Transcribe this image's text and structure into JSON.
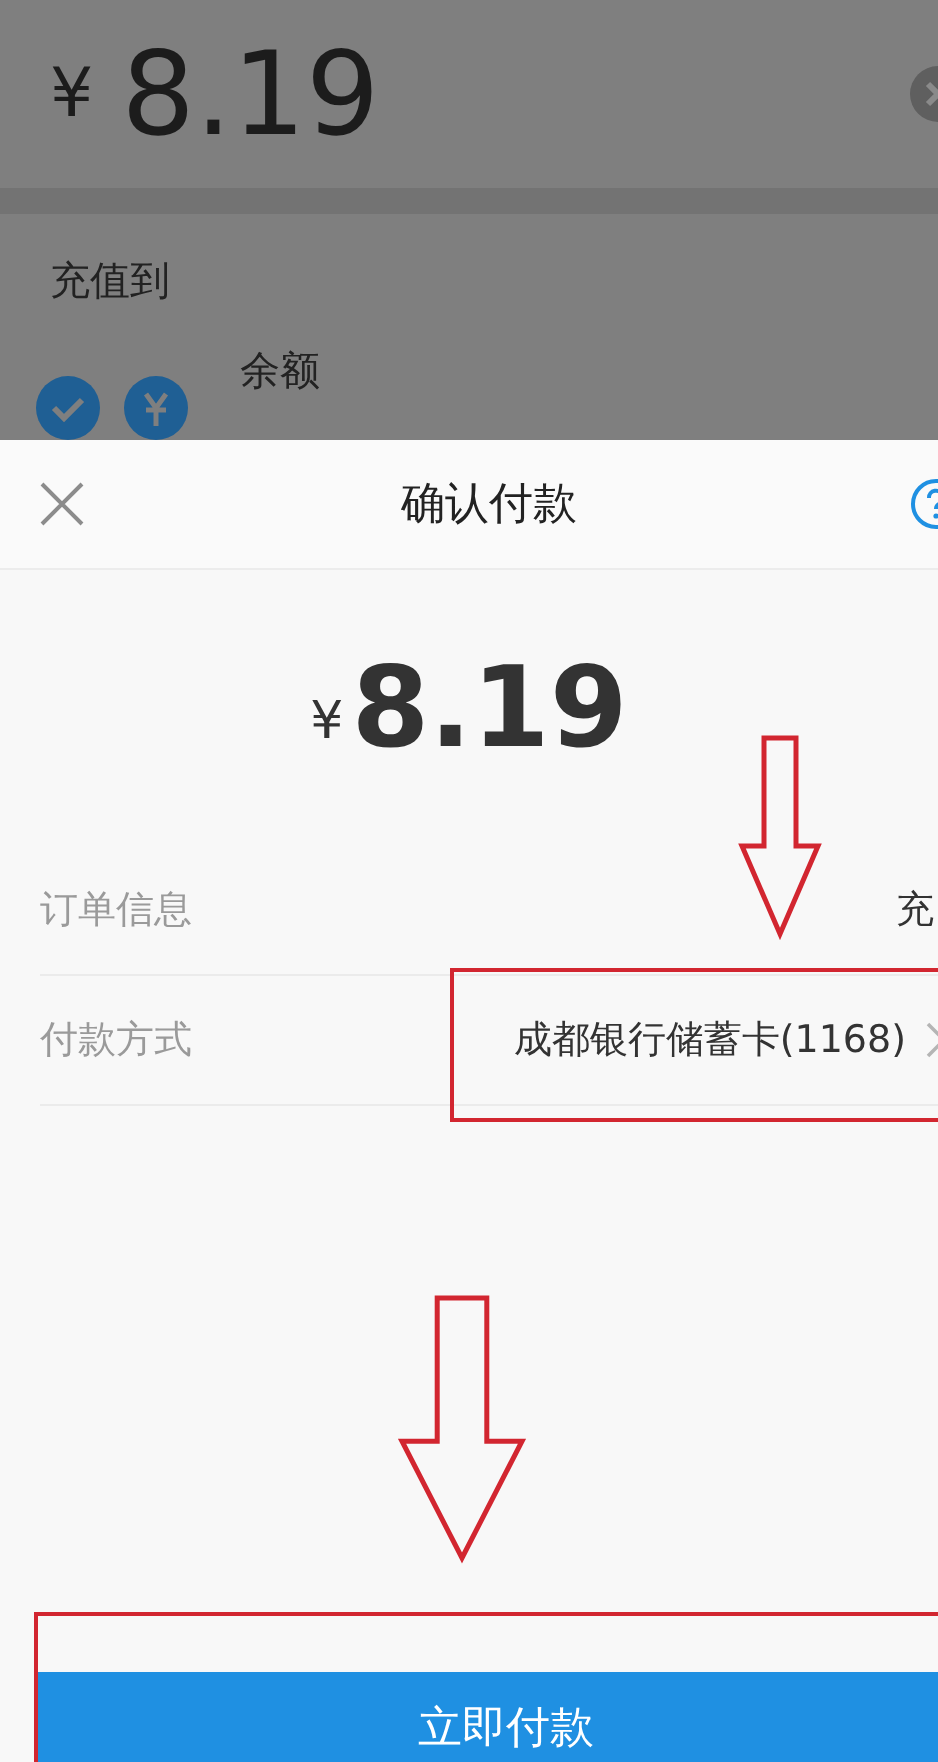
{
  "background_page": {
    "amount": {
      "currency": "¥",
      "value": "8.19"
    },
    "section_label": "充值到",
    "options": [
      {
        "label": "余额",
        "selected": true
      }
    ]
  },
  "sheet": {
    "title": "确认付款",
    "amount": {
      "currency": "¥",
      "value": "8.19"
    },
    "rows": [
      {
        "label": "订单信息",
        "value": "充",
        "kind": "info"
      },
      {
        "label": "付款方式",
        "value": "成都银行储蓄卡(1168)",
        "kind": "link"
      }
    ],
    "primary_button": "立即付款"
  }
}
